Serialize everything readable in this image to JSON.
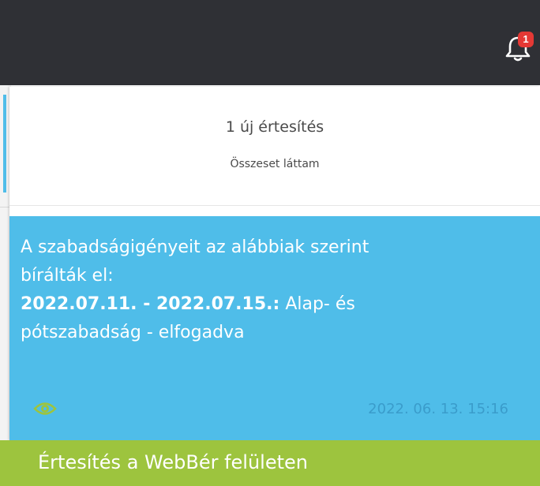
{
  "topbar": {
    "notification_count": "1",
    "bell_icon": "bell-icon"
  },
  "dropdown": {
    "new_count_text": "1 új értesítés",
    "mark_all_read": "Összeset láttam"
  },
  "notification": {
    "line1": "A szabadságigényeit az alábbiak szerint",
    "line2": "bírálták el:",
    "date_range": "2022.07.11. - 2022.07.15.:",
    "type_part1": "Alap- és",
    "type_part2": "pótszabadság - elfogadva",
    "timestamp": "2022. 06. 13. 15:16",
    "eye_icon": "eye-icon",
    "background_color": "#4fbde9",
    "eye_color": "#9dc43e"
  },
  "caption": {
    "text": "Értesítés a WebBér felületen",
    "background_color": "#9dc43e"
  }
}
